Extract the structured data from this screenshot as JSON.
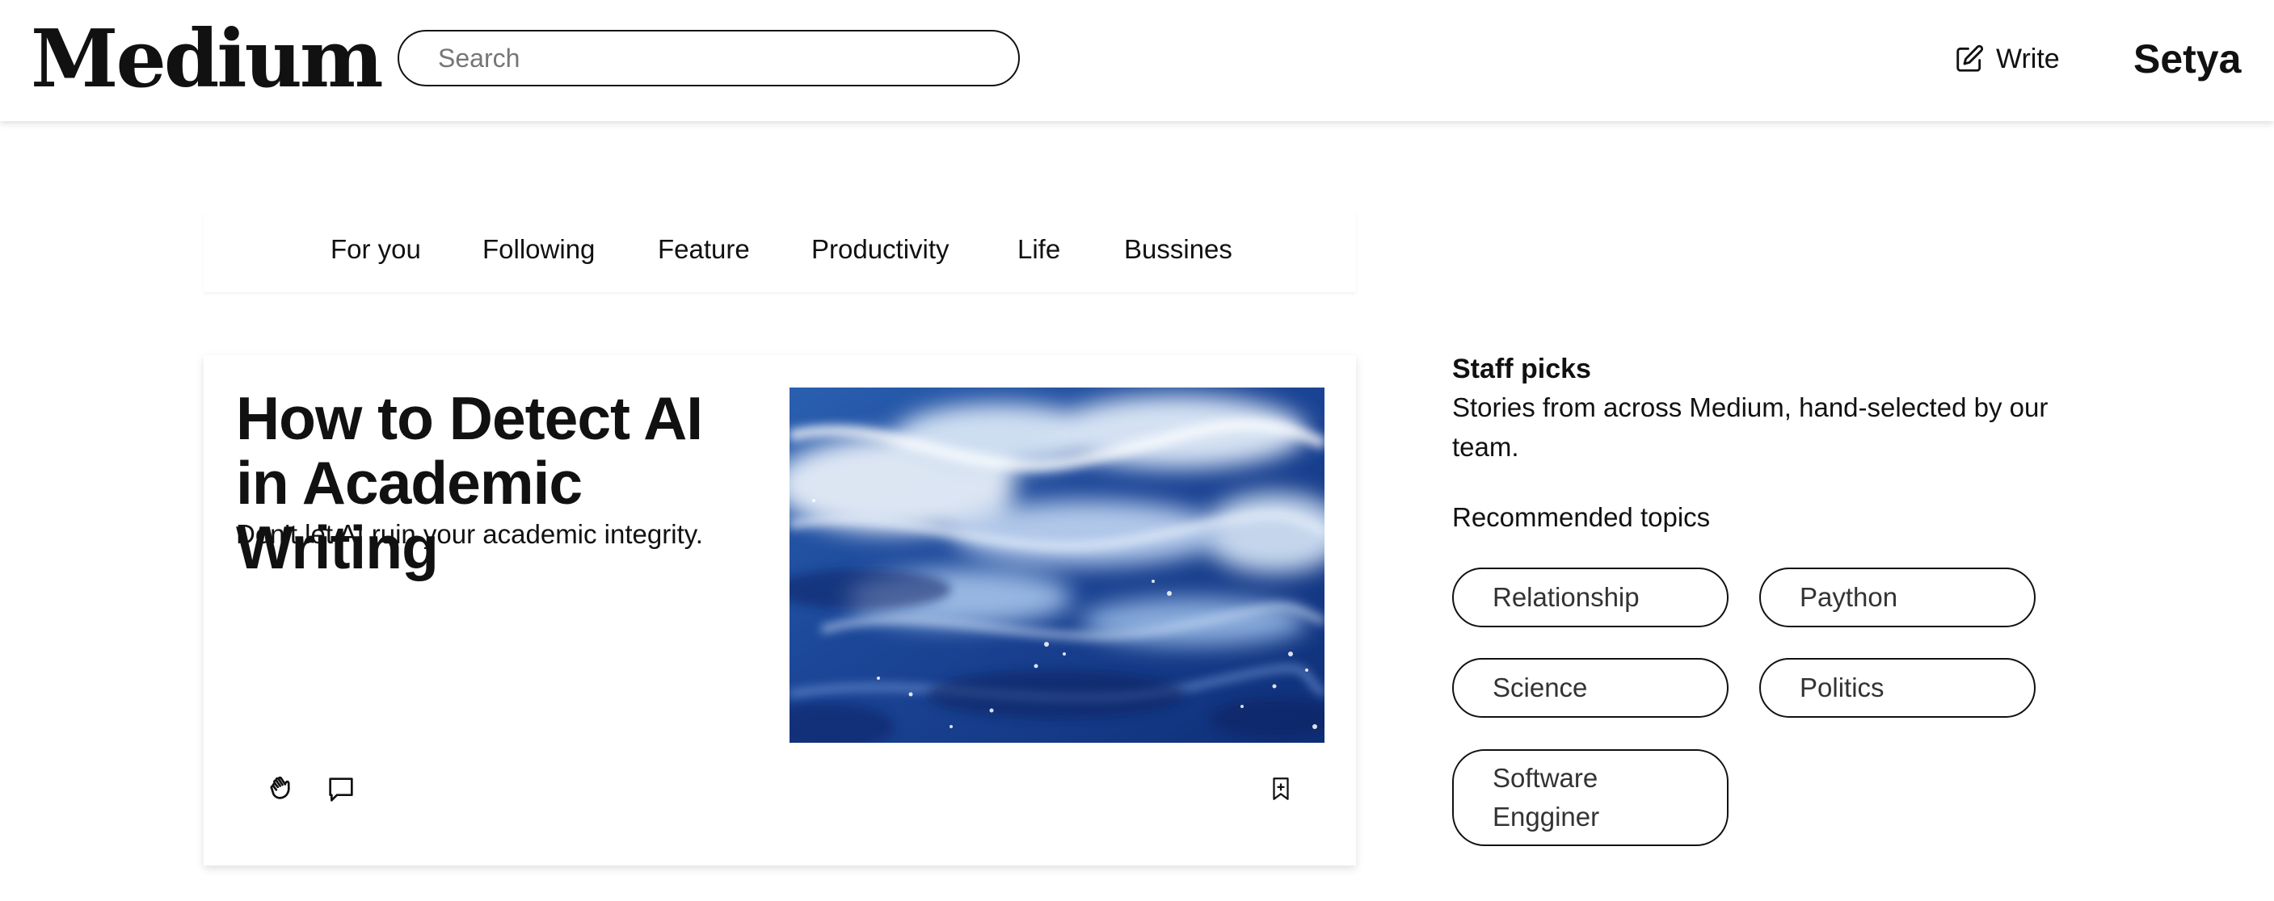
{
  "header": {
    "logo": "Medium",
    "search_placeholder": "Search",
    "search_value": "",
    "write_label": "Write",
    "username": "Setya"
  },
  "tabs": [
    "For you",
    "Following",
    "Feature",
    "Productivity",
    "Life",
    "Bussines"
  ],
  "article": {
    "title": "How to Detect AI in Academic Writing",
    "subtitle": "Don't let AI ruin your academic integrity.",
    "image": "ocean-waves-photo",
    "icons": [
      "clap-icon",
      "comment-icon",
      "bookmark-icon"
    ]
  },
  "sidebar": {
    "staff_title": "Staff picks",
    "staff_desc": "Stories from across Medium, hand-selected by our team.",
    "recommended_title": "Recommended topics",
    "topics": [
      "Relationship",
      "Paython",
      "Science",
      "Politics",
      "Software Engginer"
    ]
  },
  "colors": {
    "text": "#111111",
    "muted": "#767676",
    "background": "#ffffff",
    "ocean_dark": "#1a3f8f",
    "ocean_light": "#dfeaf6"
  }
}
